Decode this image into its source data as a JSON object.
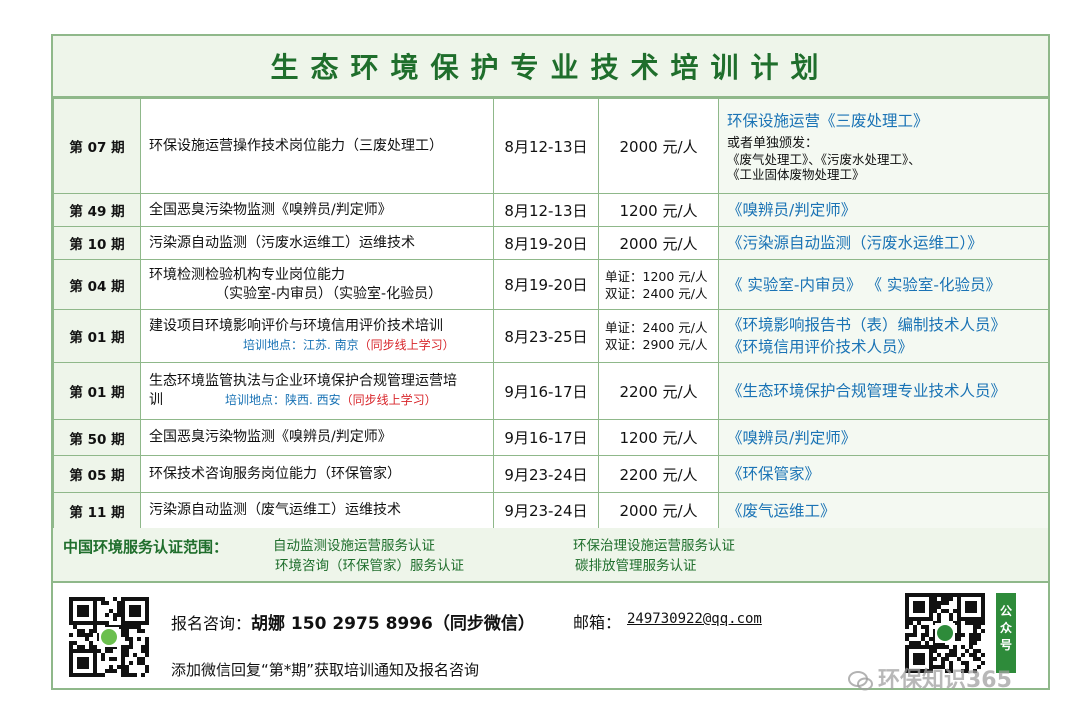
{
  "title": "生态环境保护专业技术培训计划",
  "rows": [
    {
      "period": "第 07 期",
      "course": "环保设施运营操作技术岗位能力（三废处理工）",
      "date": "8月12-13日",
      "fee": "2000 元/人",
      "cert": "环保设施运营《三废处理工》",
      "cert_note_head": "或者单独颁发：",
      "cert_note_1": "《废气处理工》、《污废水处理工》、",
      "cert_note_2": "《工业固体废物处理工》"
    },
    {
      "period": "第 49 期",
      "course": "全国恶臭污染物监测《嗅辨员/判定师》",
      "date": "8月12-13日",
      "fee": "1200 元/人",
      "cert": "《嗅辨员/判定师》"
    },
    {
      "period": "第 10 期",
      "course": "污染源自动监测（污废水运维工）运维技术",
      "date": "8月19-20日",
      "fee": "2000 元/人",
      "cert": "《污染源自动监测（污废水运维工）》"
    },
    {
      "period": "第 04 期",
      "course_1": "环境检测检验机构专业岗位能力",
      "course_2": "（实验室-内审员）（实验室-化验员）",
      "date": "8月19-20日",
      "fee_1": "单证：1200 元/人",
      "fee_2": "双证：2400 元/人",
      "cert": "《 实验室-内审员》 《 实验室-化验员》"
    },
    {
      "period": "第 01 期",
      "course_1": "建设项目环境影响评价与环境信用评价技术培训",
      "loc_label": "培训地点：江苏. 南京",
      "loc_note": "（同步线上学习）",
      "date": "8月23-25日",
      "fee_1": "单证：2400 元/人",
      "fee_2": "双证：2900 元/人",
      "cert_1": "《环境影响报告书（表）编制技术人员》",
      "cert_2": "《环境信用评价技术人员》"
    },
    {
      "period": "第 01 期",
      "course_1": "生态环境监管执法与企业环境保护合规管理运营培",
      "course_2": "训",
      "loc_label": "培训地点：陕西. 西安",
      "loc_note": "（同步线上学习）",
      "date": "9月16-17日",
      "fee": "2200 元/人",
      "cert": "《生态环境保护合规管理专业技术人员》"
    },
    {
      "period": "第 50 期",
      "course": "全国恶臭污染物监测《嗅辨员/判定师》",
      "date": "9月16-17日",
      "fee": "1200 元/人",
      "cert": "《嗅辨员/判定师》"
    },
    {
      "period": "第 05 期",
      "course": "环保技术咨询服务岗位能力（环保管家）",
      "date": "9月23-24日",
      "fee": "2200 元/人",
      "cert": "《环保管家》"
    },
    {
      "period": "第 11 期",
      "course": "污染源自动监测（废气运维工）运维技术",
      "date": "9月23-24日",
      "fee": "2000 元/人",
      "cert": "《废气运维工》"
    }
  ],
  "scope": {
    "label": "中国环境服务认证范围：",
    "items": [
      "自动监测设施运营服务认证",
      "环境咨询（环保管家）服务认证",
      "环保治理设施运营服务认证",
      "碳排放管理服务认证"
    ]
  },
  "contact": {
    "label": "报名咨询：",
    "name_phone": "胡娜 150 2975 8996（同步微信）",
    "email_label": "邮箱：",
    "email": "249730922@qq.com",
    "wechat_tip": "添加微信回复“第*期”获取培训通知及报名咨询",
    "gzh_tag": "公众号"
  },
  "watermark": "环保知识365",
  "colors": {
    "border": "#8fb88a",
    "title": "#1f6e2c",
    "cert": "#1a73b5",
    "highlight": "#d8262b",
    "panel": "#eef5ea"
  }
}
